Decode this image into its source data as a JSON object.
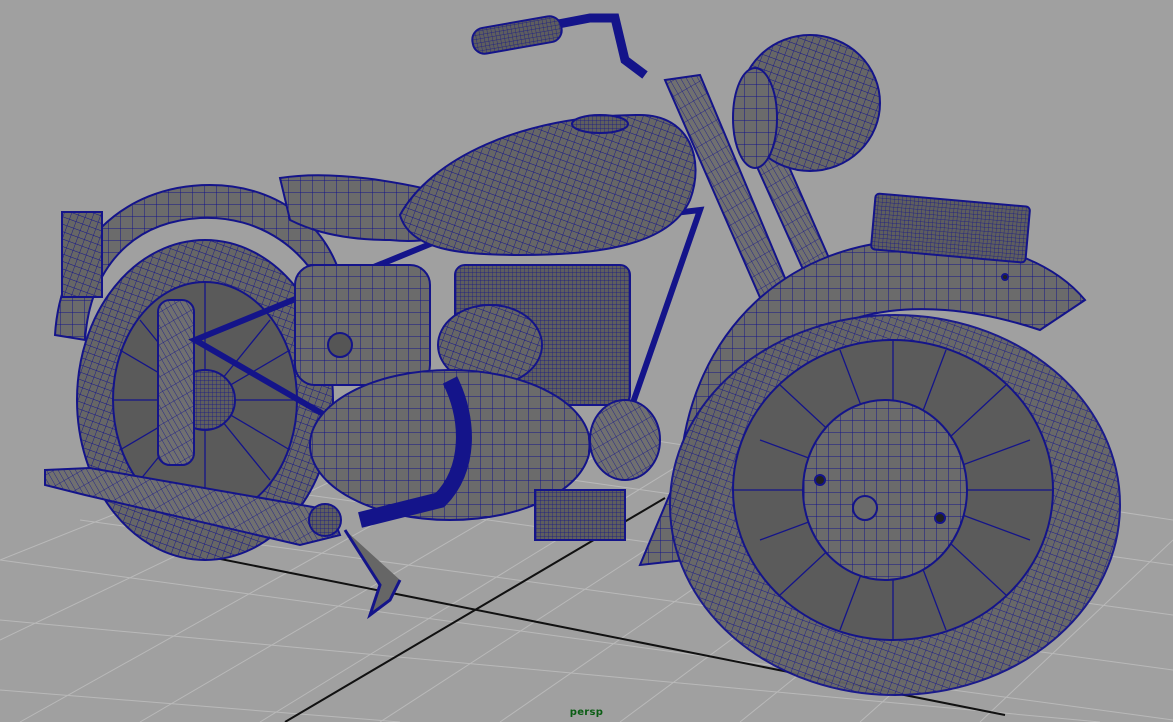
{
  "viewport": {
    "camera_label": "persp",
    "display_mode": "shaded-wireframe",
    "background_color": "#a0a0a0",
    "grid_color": "#b9b9b9",
    "axis_line_color": "#111111",
    "wire_color": "#14148a",
    "shade_color": "#6b6b6b"
  },
  "scene": {
    "object_name": "motorcycle-model"
  }
}
